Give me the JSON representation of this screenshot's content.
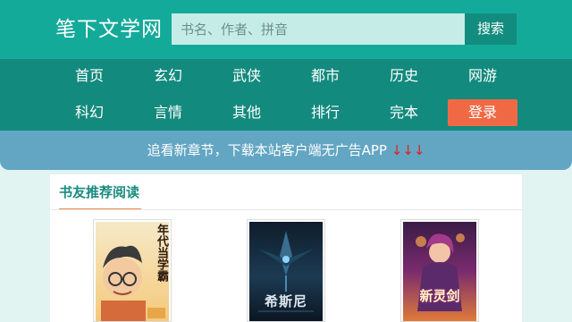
{
  "header": {
    "logo": "笔下文学网",
    "search_placeholder": "书名、作者、拼音",
    "search_button": "搜索"
  },
  "nav": {
    "items": [
      "首页",
      "玄幻",
      "武侠",
      "都市",
      "历史",
      "网游",
      "科幻",
      "言情",
      "其他",
      "排行",
      "完本",
      "登录"
    ]
  },
  "banner": {
    "text": "追看新章节，下载本站客户端无广告APP",
    "arrows": "↓↓↓"
  },
  "recommend": {
    "title": "书友推荐阅读",
    "books": [
      {
        "cover_text": "年代当学霸"
      },
      {
        "cover_text": "希斯尼"
      },
      {
        "cover_text": "新灵剑"
      }
    ]
  },
  "colors": {
    "header_bg": "#14aa9a",
    "nav_bg": "#138a7e",
    "login_bg": "#ef6a44",
    "banner_bg": "#63a6c3",
    "title_color": "#1a8c7f"
  }
}
